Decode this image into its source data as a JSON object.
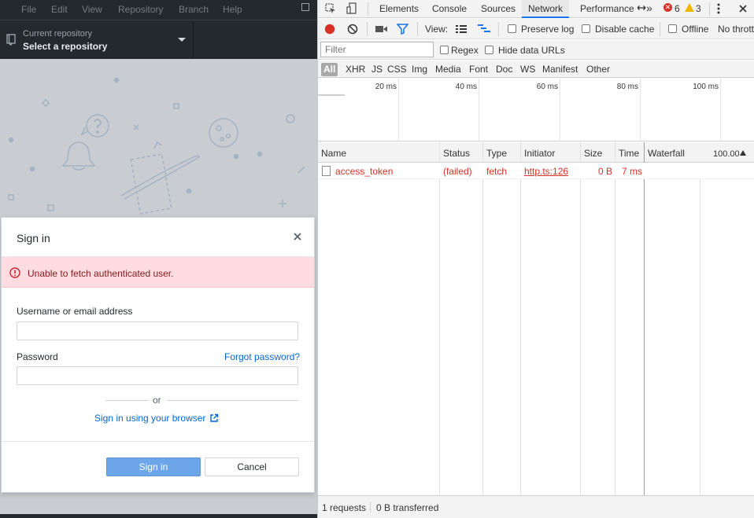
{
  "app": {
    "menu": [
      "File",
      "Edit",
      "View",
      "Repository",
      "Branch",
      "Help"
    ],
    "repo_caption": "Current repository",
    "repo_value": "Select a repository"
  },
  "dialog": {
    "title": "Sign in",
    "error": "Unable to fetch authenticated user.",
    "username_label": "Username or email address",
    "username_value": "",
    "password_label": "Password",
    "password_value": "",
    "forgot_label": "Forgot password?",
    "or_label": "or",
    "browser_label": "Sign in using your browser",
    "signin_label": "Sign in",
    "cancel_label": "Cancel"
  },
  "devtools": {
    "tabs": [
      "Elements",
      "Console",
      "Sources",
      "Network",
      "Performance"
    ],
    "active_tab": "Network",
    "more_label": "»",
    "error_count": "6",
    "warning_count": "3",
    "toolbar": {
      "view_label": "View:",
      "preserve_log": "Preserve log",
      "disable_cache": "Disable cache",
      "offline": "Offline",
      "throttle": "No throttling"
    },
    "filter": {
      "placeholder": "Filter",
      "regex": "Regex",
      "hide_data_urls": "Hide data URLs"
    },
    "types": [
      "All",
      "XHR",
      "JS",
      "CSS",
      "Img",
      "Media",
      "Font",
      "Doc",
      "WS",
      "Manifest",
      "Other"
    ],
    "overview_ticks": [
      "20 ms",
      "40 ms",
      "60 ms",
      "80 ms",
      "100 ms"
    ],
    "columns": [
      "Name",
      "Status",
      "Type",
      "Initiator",
      "Size",
      "Time",
      "Waterfall",
      "100.00"
    ],
    "rows": [
      {
        "name": "access_token",
        "status": "(failed)",
        "type": "fetch",
        "initiator": "http.ts:126",
        "size": "0 B",
        "time": "7 ms"
      }
    ],
    "status": {
      "requests": "1 requests",
      "transferred": "0 B transferred"
    }
  },
  "colors": {
    "app_chrome": "#24292e",
    "error_bg": "#ffdce0",
    "error_text": "#86181d",
    "link": "#0366d6",
    "primary_button": "#6ca6e8",
    "devtools_active": "#1a73e8",
    "request_failed": "#d93025"
  }
}
